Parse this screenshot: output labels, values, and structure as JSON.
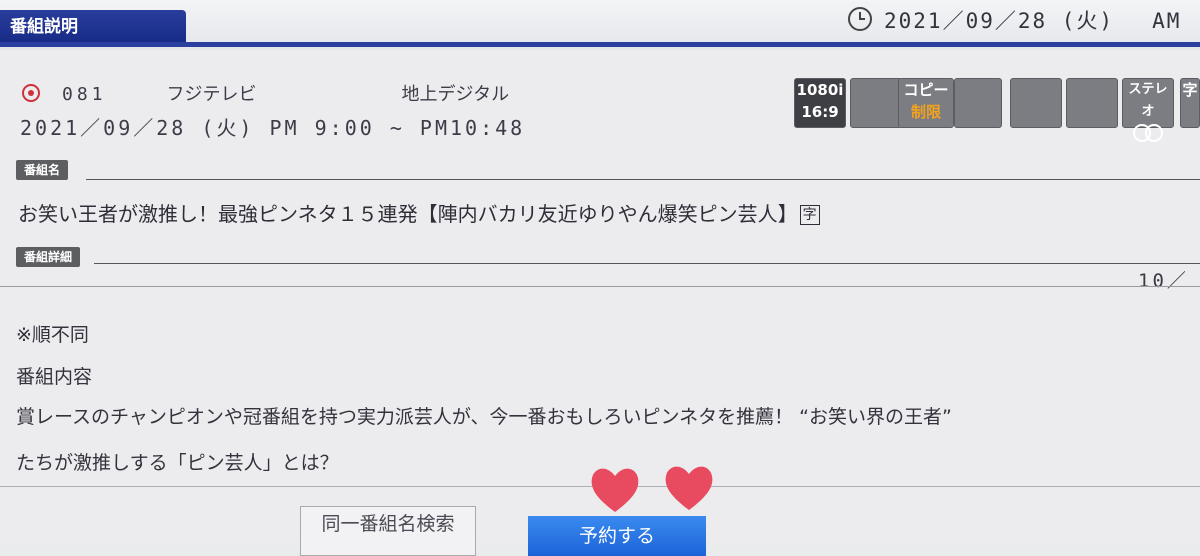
{
  "header": {
    "title": "番組説明",
    "clock_date": "2021／09／28 (火)",
    "clock_ampm": "AM"
  },
  "channel": {
    "number": "081",
    "name": "フジテレビ",
    "type": "地上デジタル"
  },
  "broadcast": {
    "datetime": "2021／09／28 (火)  PM 9:00 ~ PM10:48"
  },
  "badges": [
    {
      "line1": "1080i",
      "line2": "16:9",
      "style": "dark"
    },
    {
      "line1": "",
      "line2": "",
      "style": "gray"
    },
    {
      "line1": "コピー",
      "line2": "制限",
      "style": "gray"
    },
    {
      "line1": "",
      "line2": "",
      "style": "gray"
    },
    {
      "line1": "",
      "line2": "",
      "style": "gray"
    },
    {
      "line1": "",
      "line2": "",
      "style": "gray"
    },
    {
      "line1": "ステレオ",
      "line2": "",
      "style": "gray"
    },
    {
      "line1": "字",
      "line2": "",
      "style": "gray"
    }
  ],
  "program": {
    "name_label": "番組名",
    "title": "お笑い王者が激推し！最強ピンネタ１５連発【陣内バカリ友近ゆりやん爆笑ピン芸人】",
    "subtitle_mark": "字",
    "detail_label": "番組詳細",
    "page": "10／",
    "detail_lines": [
      "※順不同",
      "番組内容",
      "賞レースのチャンピオンや冠番組を持つ実力派芸人が、今一番おもしろいピンネタを推薦！ “お笑い界の王者”",
      "たちが激推しする「ピン芸人」とは？"
    ]
  },
  "buttons": {
    "same_name_search": "同一番組名検索",
    "reserve": "予約する"
  },
  "colors": {
    "title_bar": "#1f3290",
    "heart": "#e84a5f",
    "reserve_button": "#2472e0"
  }
}
